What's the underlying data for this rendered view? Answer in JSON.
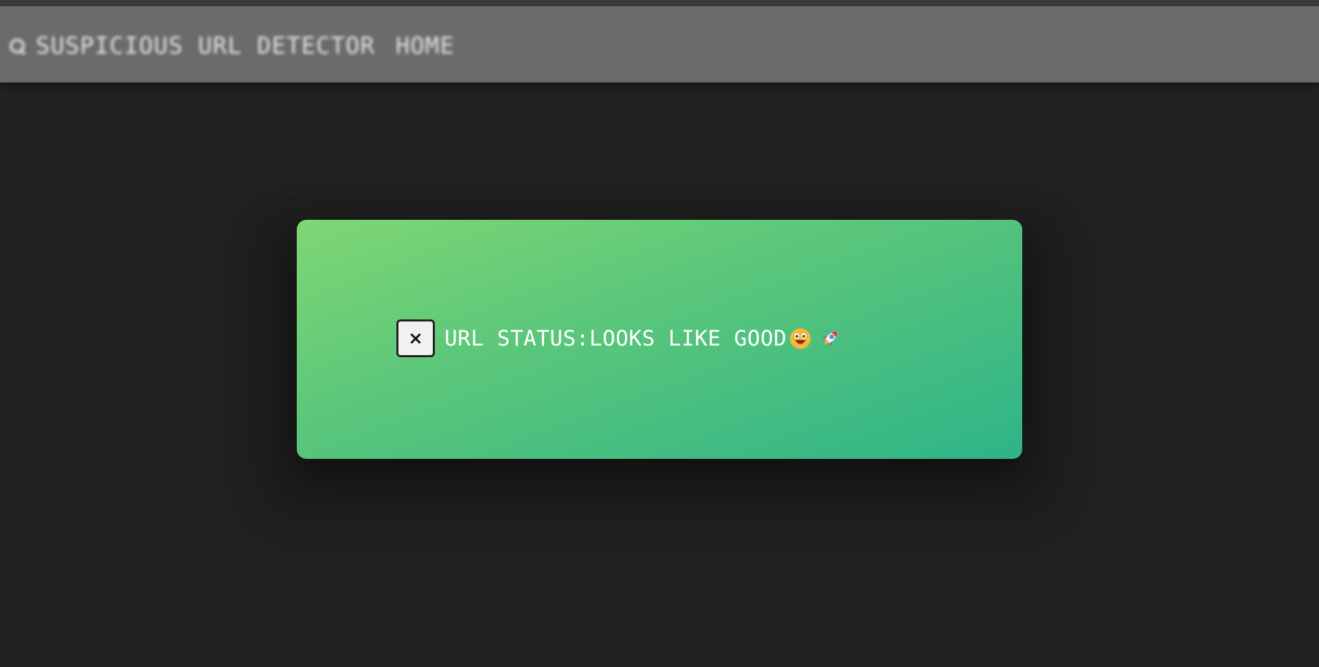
{
  "navbar": {
    "icon": "search-icon",
    "brand": "SUSPICIOUS URL DETECTOR",
    "home_link": "HOME"
  },
  "modal": {
    "close_label": "×",
    "status_text": "URL STATUS:LOOKS LIKE GOOD",
    "emojis": [
      "grinning-face-icon",
      "rocket-icon"
    ],
    "colors": {
      "gradient_start": "#7fd774",
      "gradient_end": "#2eb488"
    }
  }
}
